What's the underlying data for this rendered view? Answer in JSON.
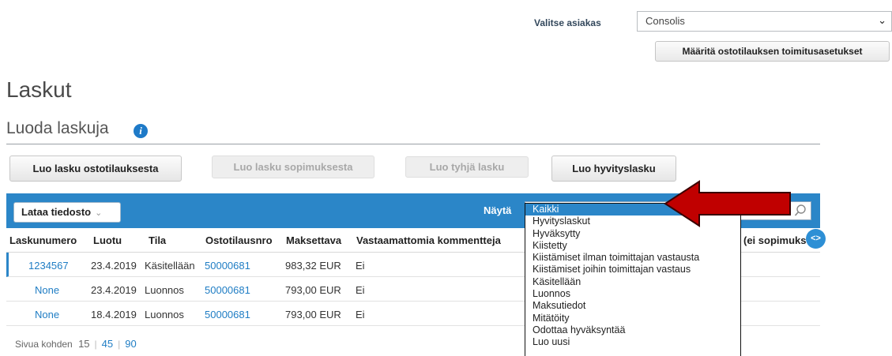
{
  "header": {
    "customer_label": "Valitse asiakas",
    "customer_value": "Consolis",
    "po_settings_button": "Määritä ostotilauksen toimitusasetukset"
  },
  "page": {
    "title": "Laskut",
    "section_title": "Luoda laskuja"
  },
  "actions": {
    "from_po": "Luo lasku ostotilauksesta",
    "from_contract": "Luo lasku sopimuksesta",
    "blank": "Luo tyhjä lasku",
    "credit_note": "Luo hyvityslasku"
  },
  "toolbar": {
    "upload_label": "Lataa tiedosto",
    "show_label": "Näytä"
  },
  "filter": {
    "options": [
      "Kaikki",
      "Hyvityslaskut",
      "Hyväksytty",
      "Kiistetty",
      "Kiistämiset ilman toimittajan vastausta",
      "Kiistämiset joihin toimittajan vastaus",
      "Käsitellään",
      "Luonnos",
      "Maksutiedot",
      "Mitätöity",
      "Odottaa hyväksyntää",
      "Luo uusi"
    ],
    "selected": "Kaikki"
  },
  "table": {
    "columns": [
      "Laskunumero",
      "Luotu",
      "Tila",
      "Ostotilausnro",
      "Maksettava",
      "Vastaamattomia kommentteja",
      "(ei sopimuks"
    ],
    "rows": [
      {
        "invoice": "1234567",
        "created": "23.4.2019",
        "status": "Käsitellään",
        "po": "50000681",
        "amount": "983,32 EUR",
        "comments": "Ei"
      },
      {
        "invoice": "None",
        "created": "23.4.2019",
        "status": "Luonnos",
        "po": "50000681",
        "amount": "793,00 EUR",
        "comments": "Ei"
      },
      {
        "invoice": "None",
        "created": "18.4.2019",
        "status": "Luonnos",
        "po": "50000681",
        "amount": "793,00 EUR",
        "comments": "Ei"
      }
    ]
  },
  "paging": {
    "label": "Sivua kohden",
    "sizes": [
      "15",
      "45",
      "90"
    ]
  },
  "colors": {
    "accent": "#2b86c8",
    "link": "#1f7dc4",
    "arrow": "#c00000"
  }
}
